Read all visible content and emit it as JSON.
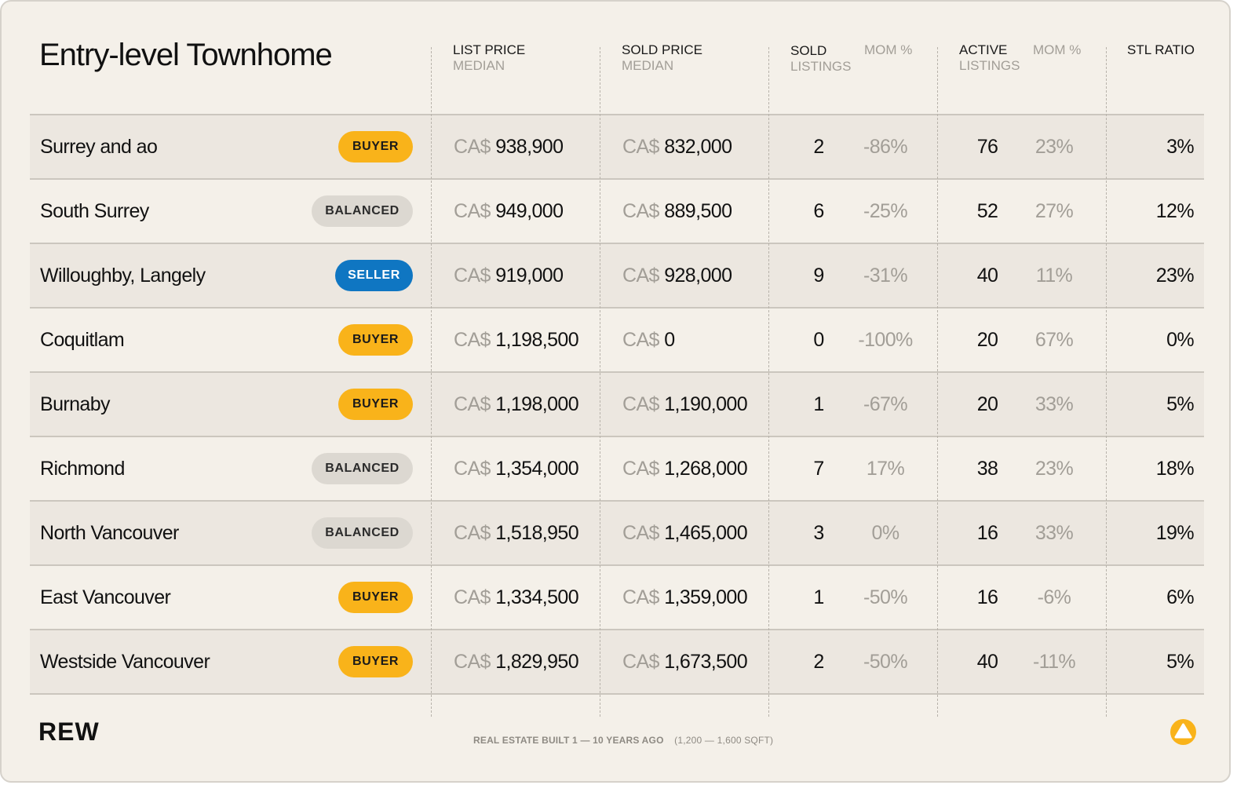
{
  "title": "Entry-level Townhome",
  "headers": {
    "list_price": {
      "line1": "LIST PRICE",
      "line2": "MEDIAN"
    },
    "sold_price": {
      "line1": "SOLD PRICE",
      "line2": "MEDIAN"
    },
    "sold_listings": {
      "line1": "SOLD",
      "line2": "LISTINGS"
    },
    "sold_mom": "MOM %",
    "active_listings": {
      "line1": "ACTIVE",
      "line2": "LISTINGS"
    },
    "active_mom": "MOM %",
    "stl_ratio": "STL RATIO"
  },
  "currency": "CA$",
  "market_colors": {
    "BUYER": "#f9b31a",
    "BALANCED": "#dcd8d1",
    "SELLER": "#0f76c2"
  },
  "rows": [
    {
      "name": "Surrey and ao",
      "market": "BUYER",
      "list_price": "938,900",
      "sold_price": "832,000",
      "sold": "2",
      "sold_mom": "-86%",
      "active": "76",
      "active_mom": "23%",
      "stl": "3%"
    },
    {
      "name": "South Surrey",
      "market": "BALANCED",
      "list_price": "949,000",
      "sold_price": "889,500",
      "sold": "6",
      "sold_mom": "-25%",
      "active": "52",
      "active_mom": "27%",
      "stl": "12%"
    },
    {
      "name": "Willoughby, Langely",
      "market": "SELLER",
      "list_price": "919,000",
      "sold_price": "928,000",
      "sold": "9",
      "sold_mom": "-31%",
      "active": "40",
      "active_mom": "11%",
      "stl": "23%"
    },
    {
      "name": "Coquitlam",
      "market": "BUYER",
      "list_price": "1,198,500",
      "sold_price": "0",
      "sold": "0",
      "sold_mom": "-100%",
      "active": "20",
      "active_mom": "67%",
      "stl": "0%"
    },
    {
      "name": "Burnaby",
      "market": "BUYER",
      "list_price": "1,198,000",
      "sold_price": "1,190,000",
      "sold": "1",
      "sold_mom": "-67%",
      "active": "20",
      "active_mom": "33%",
      "stl": "5%"
    },
    {
      "name": "Richmond",
      "market": "BALANCED",
      "list_price": "1,354,000",
      "sold_price": "1,268,000",
      "sold": "7",
      "sold_mom": "17%",
      "active": "38",
      "active_mom": "23%",
      "stl": "18%"
    },
    {
      "name": "North Vancouver",
      "market": "BALANCED",
      "list_price": "1,518,950",
      "sold_price": "1,465,000",
      "sold": "3",
      "sold_mom": "0%",
      "active": "16",
      "active_mom": "33%",
      "stl": "19%"
    },
    {
      "name": "East Vancouver",
      "market": "BUYER",
      "list_price": "1,334,500",
      "sold_price": "1,359,000",
      "sold": "1",
      "sold_mom": "-50%",
      "active": "16",
      "active_mom": "-6%",
      "stl": "6%"
    },
    {
      "name": "Westside Vancouver",
      "market": "BUYER",
      "list_price": "1,829,950",
      "sold_price": "1,673,500",
      "sold": "2",
      "sold_mom": "-50%",
      "active": "40",
      "active_mom": "-11%",
      "stl": "5%"
    }
  ],
  "footer": {
    "logo": "REW",
    "note": "REAL ESTATE BUILT 1 — 10 YEARS AGO",
    "note_sub": "(1,200 — 1,600 SQFT)",
    "brand_icon": "rew-triangle-icon",
    "brand_color": "#f9b31a"
  }
}
